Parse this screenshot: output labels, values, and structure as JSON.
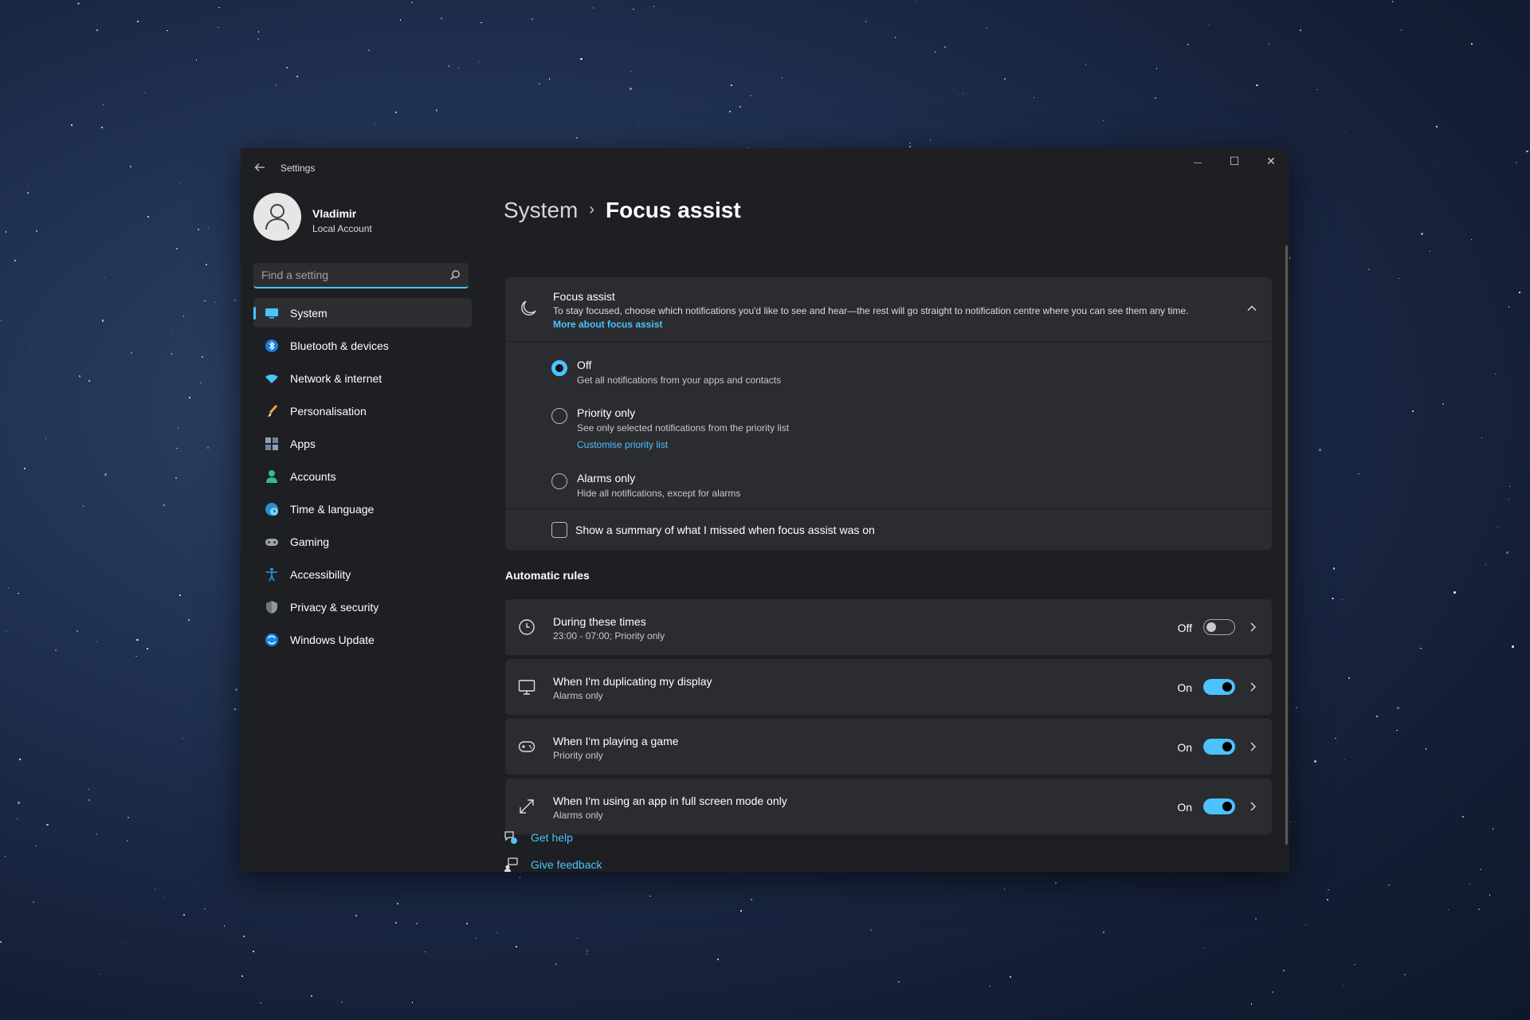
{
  "window": {
    "app_title": "Settings",
    "controls": {
      "minimize": "—",
      "maximize": "☐",
      "close": "✕"
    }
  },
  "user": {
    "name": "Vladimir",
    "account_type": "Local Account"
  },
  "search": {
    "placeholder": "Find a setting"
  },
  "nav": {
    "items": [
      {
        "label": "System",
        "icon": "system-icon",
        "active": true
      },
      {
        "label": "Bluetooth & devices",
        "icon": "bluetooth-icon"
      },
      {
        "label": "Network & internet",
        "icon": "wifi-icon"
      },
      {
        "label": "Personalisation",
        "icon": "brush-icon"
      },
      {
        "label": "Apps",
        "icon": "apps-icon"
      },
      {
        "label": "Accounts",
        "icon": "person-icon"
      },
      {
        "label": "Time & language",
        "icon": "globe-clock-icon"
      },
      {
        "label": "Gaming",
        "icon": "gamepad-icon"
      },
      {
        "label": "Accessibility",
        "icon": "accessibility-icon"
      },
      {
        "label": "Privacy & security",
        "icon": "shield-icon"
      },
      {
        "label": "Windows Update",
        "icon": "update-icon"
      }
    ]
  },
  "breadcrumb": {
    "parent": "System",
    "separator": "›",
    "current": "Focus assist"
  },
  "focus_assist": {
    "title": "Focus assist",
    "description": "To stay focused, choose which notifications you'd like to see and hear—the rest will go straight to notification centre where you can see them any time.",
    "link": "More about focus assist",
    "options": [
      {
        "label": "Off",
        "description": "Get all notifications from your apps and contacts",
        "selected": true
      },
      {
        "label": "Priority only",
        "description": "See only selected notifications from the priority list",
        "link": "Customise priority list",
        "selected": false
      },
      {
        "label": "Alarms only",
        "description": "Hide all notifications, except for alarms",
        "selected": false
      }
    ],
    "summary_checkbox": {
      "label": "Show a summary of what I missed when focus assist was on",
      "checked": false
    }
  },
  "automatic_rules": {
    "title": "Automatic rules",
    "rules": [
      {
        "title": "During these times",
        "subtitle": "23:00 - 07:00; Priority only",
        "state": "Off",
        "on": false,
        "icon": "clock-icon"
      },
      {
        "title": "When I'm duplicating my display",
        "subtitle": "Alarms only",
        "state": "On",
        "on": true,
        "icon": "monitor-icon"
      },
      {
        "title": "When I'm playing a game",
        "subtitle": "Priority only",
        "state": "On",
        "on": true,
        "icon": "gamepad-icon"
      },
      {
        "title": "When I'm using an app in full screen mode only",
        "subtitle": "Alarms only",
        "state": "On",
        "on": true,
        "icon": "fullscreen-icon"
      }
    ]
  },
  "footer": {
    "get_help": "Get help",
    "give_feedback": "Give feedback"
  },
  "colors": {
    "accent": "#4cc2ff",
    "window_bg": "#1e1f22",
    "card_bg": "#2b2c2f"
  }
}
